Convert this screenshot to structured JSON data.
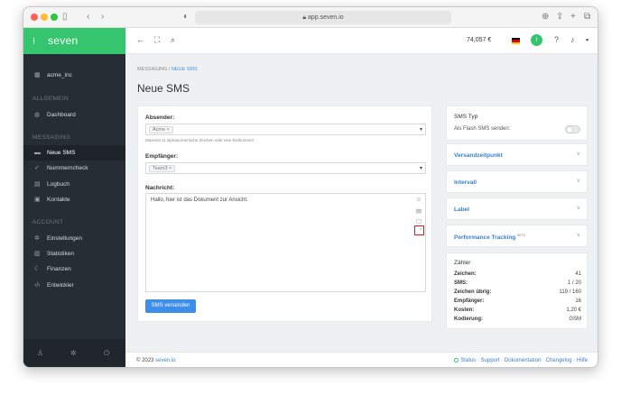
{
  "browser": {
    "url": "app.seven.io"
  },
  "sidebar": {
    "brand": "seven",
    "account_name": "acme_inc",
    "sections": [
      {
        "heading": "ALLGEMEIN"
      },
      {
        "heading": "MESSAGING"
      },
      {
        "heading": "ACCOUNT"
      }
    ],
    "items": [
      {
        "label": "Dashboard"
      },
      {
        "label": "Neue SMS"
      },
      {
        "label": "Nummerncheck"
      },
      {
        "label": "Logbuch"
      },
      {
        "label": "Kontakte"
      },
      {
        "label": "Einstellungen"
      },
      {
        "label": "Statistiken"
      },
      {
        "label": "Finanzen"
      },
      {
        "label": "Entwickler"
      }
    ]
  },
  "topbar": {
    "balance": "74,057 €"
  },
  "breadcrumb": {
    "root": "MESSAGING",
    "separator": "/",
    "current": "NEUE SMS"
  },
  "page_title": "Neue SMS",
  "form": {
    "sender_label": "Absender:",
    "sender_tag": "Acme",
    "sender_hint": "Maximal 11 alphanumerische Zeichen oder eine Rufnummer",
    "recipient_label": "Empfänger:",
    "recipient_tag": "Team3",
    "message_label": "Nachricht:",
    "message_text": "Hallo, hier ist das Dokument zur Ansicht:",
    "send_button": "SMS versenden"
  },
  "panels": {
    "sms_type_title": "SMS Typ",
    "flash_label": "Als Flash SMS senden:",
    "flash_enabled": false,
    "collapsibles": [
      {
        "title": "Versandzeitpunkt"
      },
      {
        "title": "Intervall"
      },
      {
        "title": "Label"
      },
      {
        "title": "Performance Tracking",
        "badge": "BETA"
      }
    ]
  },
  "counter": {
    "title": "Zähler",
    "rows": [
      {
        "key": "Zeichen:",
        "value": "41"
      },
      {
        "key": "SMS:",
        "value": "1 / 20"
      },
      {
        "key": "Zeichen übrig:",
        "value": "119 / 160"
      },
      {
        "key": "Empfänger:",
        "value": "16"
      },
      {
        "key": "Kosten:",
        "value": "1,20 €"
      },
      {
        "key": "Kodierung:",
        "value": "GSM"
      }
    ]
  },
  "footer": {
    "copyright": "© 2023",
    "copyright_link": "seven.io",
    "links": [
      "Status",
      "Support",
      "Dokumentation",
      "Changelog",
      "Hilfe"
    ]
  },
  "colors": {
    "brand": "#34c56e",
    "sidebar": "#262d34",
    "link": "#3a80d0",
    "button": "#3d8ee8",
    "highlight": "#e0201c"
  }
}
